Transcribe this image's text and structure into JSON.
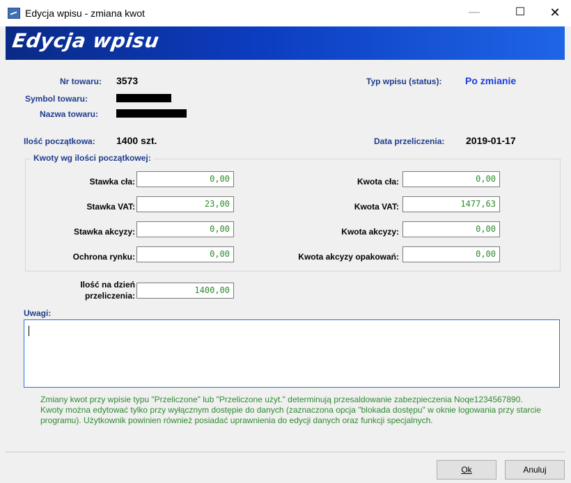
{
  "window": {
    "title": "Edycja wpisu - zmiana kwot",
    "minimize": "—",
    "maximize": "☐",
    "close": "✕"
  },
  "banner": {
    "title": "Edycja wpisu"
  },
  "header": {
    "nr_label": "Nr towaru:",
    "nr_value": "3573",
    "symbol_label": "Symbol towaru:",
    "name_label": "Nazwa towaru:",
    "status_label": "Typ wpisu (status):",
    "status_value": "Po zmianie",
    "qty_label": "Ilość początkowa:",
    "qty_value": "1400 szt.",
    "date_label": "Data przeliczenia:",
    "date_value": "2019-01-17"
  },
  "group": {
    "title": "Kwoty wg ilości początkowej:",
    "left": [
      {
        "label": "Stawka cła:",
        "value": "0,00"
      },
      {
        "label": "Stawka VAT:",
        "value": "23,00"
      },
      {
        "label": "Stawka akcyzy:",
        "value": "0,00"
      },
      {
        "label": "Ochrona rynku:",
        "value": "0,00"
      }
    ],
    "right": [
      {
        "label": "Kwota cła:",
        "value": "0,00"
      },
      {
        "label": "Kwota VAT:",
        "value": "1477,63"
      },
      {
        "label": "Kwota akcyzy:",
        "value": "0,00"
      },
      {
        "label": "Kwota akcyzy opakowań:",
        "value": "0,00"
      }
    ]
  },
  "recalc": {
    "label_line1": "Ilość na dzień",
    "label_line2": "przeliczenia:",
    "value": "1400,00"
  },
  "notes": {
    "label": "Uwagi:",
    "value": ""
  },
  "info_text": "Zmiany kwot przy wpisie typu \"Przeliczone\" lub \"Przeliczone użyt.\" determinują przesaldowanie zabezpieczenia Noqe1234567890. Kwoty można edytować tylko przy wyłącznym dostępie do danych (zaznaczona opcja \"blokada dostępu\" w oknie logowania przy starcie programu). Użytkownik powinien również posiadać uprawnienia do edycji danych oraz funkcji specjalnych.",
  "buttons": {
    "ok": "Ok",
    "cancel": "Anuluj"
  },
  "colors": {
    "banner_start": "#0a2a86",
    "banner_end": "#1f65e6",
    "label": "#1e3c8c",
    "status": "#1a3dde",
    "field_text": "#2a8a2a",
    "info_text": "#2f8a2f"
  },
  "icons": {
    "app": "app-icon"
  }
}
